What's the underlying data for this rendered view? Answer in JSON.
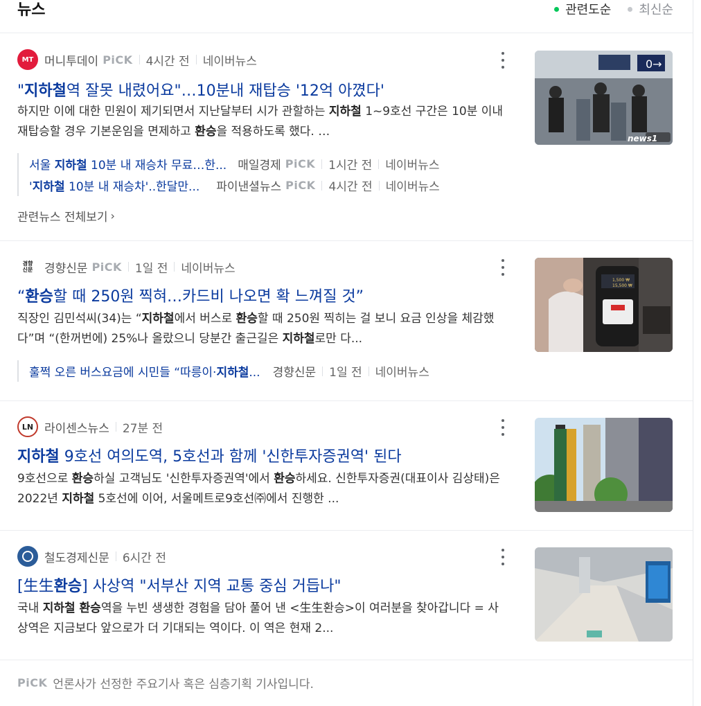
{
  "header": {
    "title": "뉴스",
    "sort_options": [
      "관련도순",
      "최신순"
    ]
  },
  "articles": [
    {
      "press": "머니투데이",
      "logo_text": "MT",
      "pick_label": "PiCK",
      "time": "4시간 전",
      "portal": "네이버뉴스",
      "title_pre": "\"",
      "title_bold": "지하철",
      "title_post": "역 잘못 내렸어요\"…10분내 재탑승 '12억 아꼈다'",
      "desc_1": "하지만 이에 대한 민원이 제기되면서 지난달부터 시가 관할하는 ",
      "desc_2": "지하철",
      "desc_3": " 1~9호선 구간은 10분 이내 재탑승할 경우 기본운임을 면제하고 ",
      "desc_4": "환승",
      "desc_5": "을 적용하도록 했다. …",
      "related": [
        {
          "pre": "서울 ",
          "bold": "지하철",
          "post": " 10분 내 재승차 무료…한...",
          "press": "매일경제",
          "pick": "PiCK",
          "time": "1시간 전",
          "portal": "네이버뉴스"
        },
        {
          "pre": "'",
          "bold": "지하철",
          "post": " 10분 내 재승차'..한달만...",
          "press": "파이낸셜뉴스",
          "pick": "PiCK",
          "time": "4시간 전",
          "portal": "네이버뉴스"
        }
      ],
      "related_all": "관련뉴스 전체보기"
    },
    {
      "press": "경향신문",
      "logo_text": "경향\n신문",
      "pick_label": "PiCK",
      "time": "1일 전",
      "portal": "네이버뉴스",
      "title_pre": "“",
      "title_bold": "환승",
      "title_post": "할 때 250원 찍혀…카드비 나오면 확 느껴질 것”",
      "desc_1": "직장인 김민석씨(34)는 “",
      "desc_2": "지하철",
      "desc_3": "에서 버스로 ",
      "desc_4": "환승",
      "desc_5": "할 때 250원 찍히는 걸 보니 요금 인상을 체감했다”며 “(한꺼번에) 25%나 올랐으니 당분간 출근길은 ",
      "desc_6": "지하철",
      "desc_7": "로만 다...",
      "related": [
        {
          "pre": "훌쩍 오른 버스요금에 시민들 “따릉이·",
          "bold": "지하철",
          "post": "...",
          "press": "경향신문",
          "time": "1일 전",
          "portal": "네이버뉴스"
        }
      ]
    },
    {
      "press": "라이센스뉴스",
      "logo_text": "LN",
      "time": "27분 전",
      "title_bold": "지하철",
      "title_post": " 9호선 여의도역, 5호선과 함께 '신한투자증권역' 된다",
      "desc_1": "9호선으로 ",
      "desc_2": "환승",
      "desc_3": "하실 고객님도 '신한투자증권역'에서 ",
      "desc_4": "환승",
      "desc_5": "하세요. 신한투자증권(대표이사 김상태)은 2022년 ",
      "desc_6": "지하철",
      "desc_7": " 5호선에 이어, 서울메트로9호선㈜에서 진행한 ..."
    },
    {
      "press": "철도경제신문",
      "time": "6시간 전",
      "title_pre": "[生生",
      "title_bold": "환승",
      "title_post": "] 사상역 \"서부산 지역 교통 중심 거듭나\"",
      "desc_1": "국내 ",
      "desc_2": "지하철 환승",
      "desc_3": "역을 누빈 생생한 경험을 담아 풀어 낸 <生生환승>이 여러분을 찾아갑니다 = 사상역은 지금보다 앞으로가 더 기대되는 역이다. 이 역은 현재 2..."
    }
  ],
  "thumb_text": {
    "news1": "news1"
  },
  "footer": {
    "pick_label": "PiCK",
    "text": "언론사가 선정한 주요기사 혹은 심층기획 기사입니다."
  },
  "colors": {
    "accent_green": "#03c75a",
    "link_blue": "#0a3a9e"
  }
}
